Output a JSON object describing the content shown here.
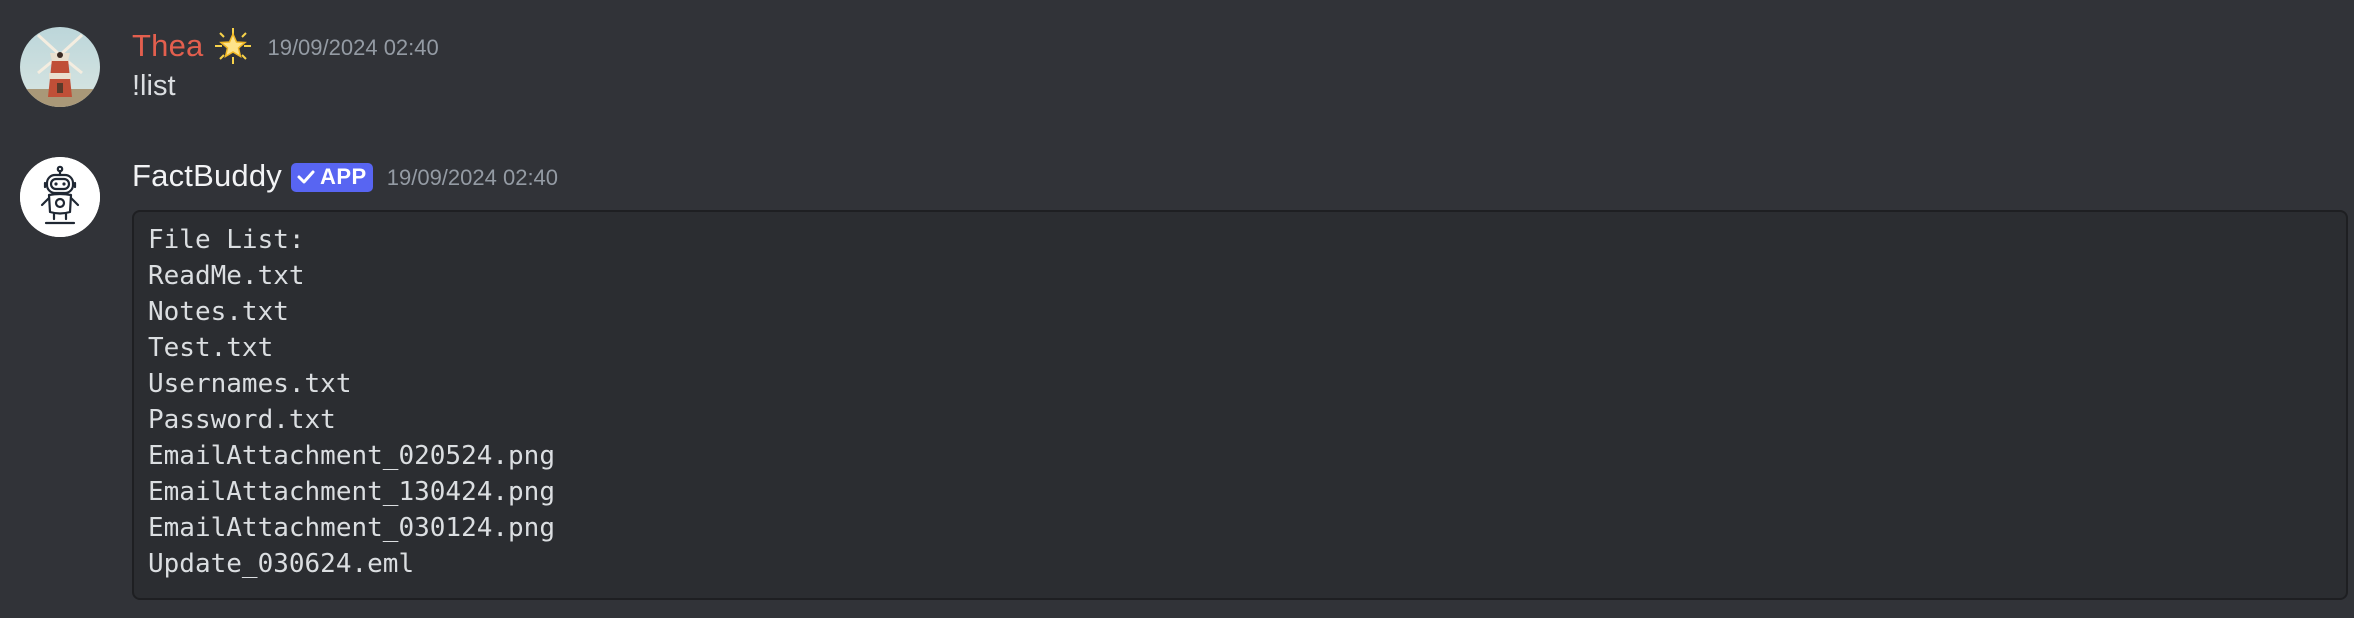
{
  "messages": [
    {
      "author": "Thea",
      "author_color": "#e35f4e",
      "role_icon": "star-icon",
      "timestamp": "19/09/2024 02:40",
      "content": "!list"
    },
    {
      "author": "FactBuddy",
      "author_color": "#f2f3f5",
      "tag": "APP",
      "tag_icon": "checkmark-icon",
      "tag_color": "#5865f2",
      "timestamp": "19/09/2024 02:40",
      "code_lines": [
        "File List:",
        "ReadMe.txt",
        "Notes.txt",
        "Test.txt",
        "Usernames.txt",
        "Password.txt",
        "EmailAttachment_020524.png",
        "EmailAttachment_130424.png",
        "EmailAttachment_030124.png",
        "Update_030624.eml"
      ]
    }
  ],
  "colors": {
    "background": "#313338",
    "codeblock_background": "#2b2d31",
    "timestamp": "#949ba4",
    "text": "#dbdee1"
  }
}
